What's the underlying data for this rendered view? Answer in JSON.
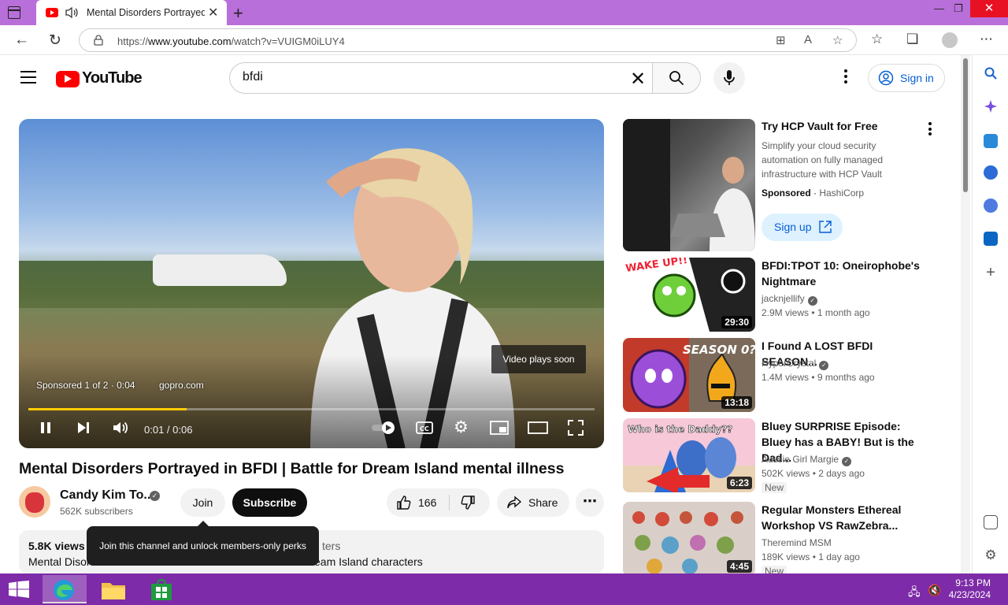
{
  "browser": {
    "tab_title": "Mental Disorders Portrayed in BFDI",
    "url_prefix": "https://",
    "url_host": "www.youtube.com",
    "url_path": "/watch?v=VUIGM0iLUY4"
  },
  "youtube": {
    "logo_text": "YouTube",
    "search_value": "bfdi",
    "sign_in": "Sign in"
  },
  "player": {
    "plays_soon": "Video plays soon",
    "ad_info": "Sponsored 1 of 2 · 0:04",
    "ad_domain": "gopro.com",
    "time": "0:01 / 0:06",
    "progress_fraction": 0.28
  },
  "video": {
    "title": "Mental Disorders Portrayed in BFDI | Battle for Dream Island mental illness",
    "channel": "Candy Kim To...",
    "subscribers": "562K subscribers",
    "join": "Join",
    "subscribe": "Subscribe",
    "likes": "166",
    "share": "Share",
    "views": "5.8K views",
    "desc_tail1": "ters",
    "desc_line2": "Mental Disor",
    "desc_tail2": "eam Island characters",
    "tooltip": "Join this channel and unlock members-only perks"
  },
  "ad": {
    "title": "Try HCP Vault for Free",
    "description": "Simplify your cloud security automation on fully managed infrastructure with HCP Vault",
    "sponsored": "Sponsored",
    "advertiser": "HashiCorp",
    "cta": "Sign up"
  },
  "recommendations": [
    {
      "title": "BFDI:TPOT 10: Oneirophobe's Nightmare",
      "channel": "jacknjellify",
      "meta": "2.9M views • 1 month ago",
      "duration": "29:30",
      "thumb_text": "WAKE UP!!",
      "new": ""
    },
    {
      "title": "I Found A LOST BFDI SEASON...",
      "channel": "HyperCrystal",
      "meta": "1.4M views • 9 months ago",
      "duration": "13:18",
      "thumb_text": "SEASON 0?",
      "new": ""
    },
    {
      "title": "Bluey SURPRISE Episode: Bluey has a BABY! But is the Dad...",
      "channel": "Aussie Girl Margie",
      "meta": "502K views • 2 days ago",
      "duration": "6:23",
      "thumb_text": "Who is the Daddy??",
      "new": "New"
    },
    {
      "title": "Regular Monsters Ethereal Workshop VS RawZebra...",
      "channel": "Theremind MSM",
      "meta": "189K views • 1 day ago",
      "duration": "4:45",
      "thumb_text": "",
      "new": "New"
    }
  ],
  "taskbar": {
    "time": "9:13 PM",
    "date": "4/23/2024"
  },
  "colors": {
    "tabbar": "#b86fd9",
    "taskbar": "#7d2ba8",
    "yt_red": "#ff0000",
    "link_blue": "#065fd4"
  }
}
